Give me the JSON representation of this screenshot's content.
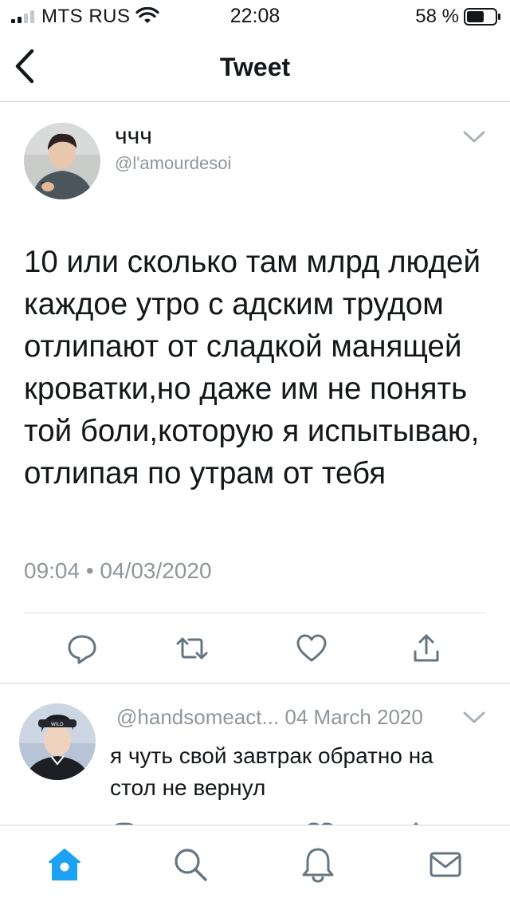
{
  "status_bar": {
    "carrier": "MTS RUS",
    "time": "22:08",
    "battery_percent": "58 %",
    "icons": [
      "signal-icon",
      "wifi-icon",
      "battery-icon"
    ]
  },
  "nav": {
    "title": "Tweet",
    "back_icon": "chevron-left-icon"
  },
  "tweet": {
    "display_name": "ччч",
    "handle": "@l'amourdesoi",
    "text": "10 или сколько там млрд людей каждое утро с адским трудом отлипают от сладкой манящей кроватки,но даже им не понять той боли,которую я испытываю, отлипая по утрам от тебя",
    "timestamp": "09:04 • 04/03/2020",
    "actions": [
      "reply-icon",
      "retweet-icon",
      "like-icon",
      "share-icon"
    ]
  },
  "reply": {
    "handle": "@handsomeact...",
    "date": "04 March 2020",
    "text": "я чуть свой завтрак обратно на стол не вернул"
  },
  "tab_bar": {
    "tabs": [
      "home-icon",
      "search-icon",
      "notifications-icon",
      "messages-icon"
    ]
  },
  "colors": {
    "accent": "#1da1f2",
    "icon_gray": "#66757f",
    "muted_text": "#8f969c",
    "text": "#14171a"
  }
}
